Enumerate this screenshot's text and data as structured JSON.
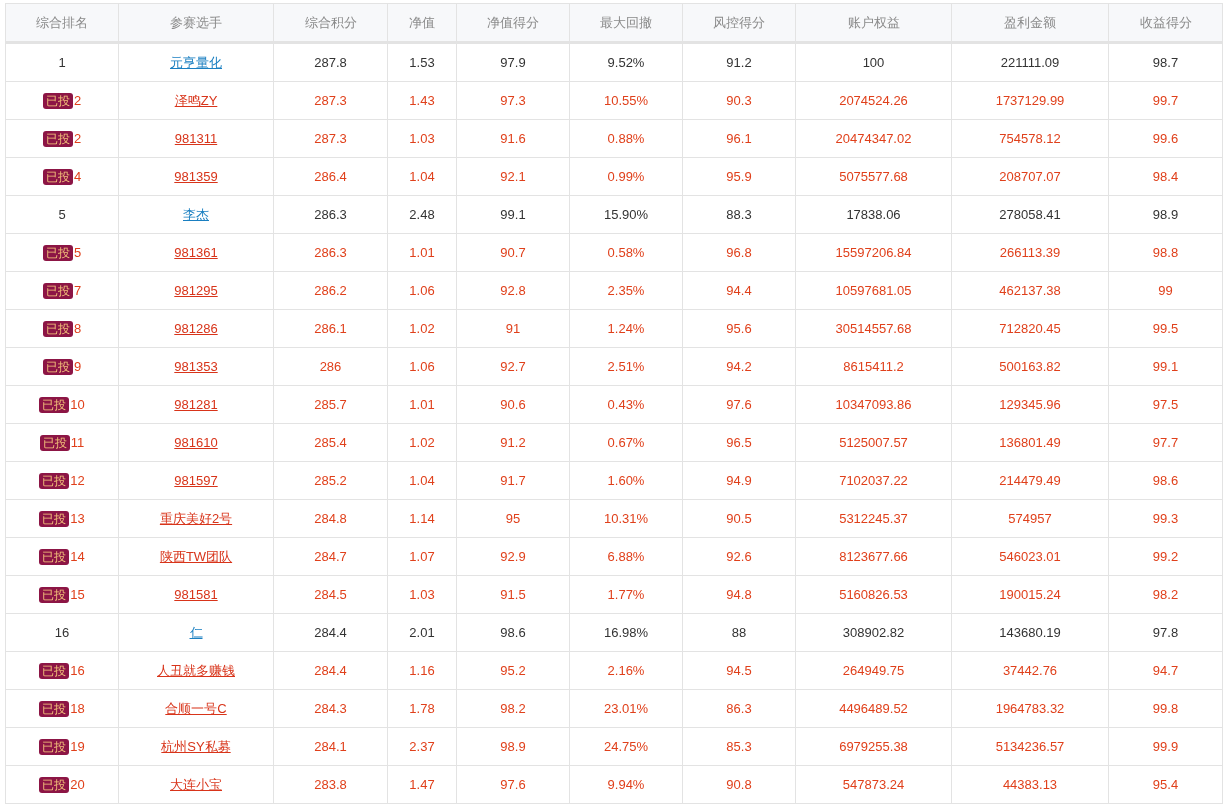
{
  "table": {
    "columns": [
      "综合排名",
      "参赛选手",
      "综合积分",
      "净值",
      "净值得分",
      "最大回撤",
      "风控得分",
      "账户权益",
      "盈利金额",
      "收益得分"
    ],
    "rows": [
      {
        "invested": false,
        "rank": "1",
        "player": "元亨量化",
        "values": [
          "287.8",
          "1.53",
          "97.9",
          "9.52%",
          "91.2",
          "100",
          "221111.09",
          "98.7"
        ]
      },
      {
        "invested": true,
        "badge": "已投",
        "rank": "2",
        "player": "泽鸣ZY",
        "values": [
          "287.3",
          "1.43",
          "97.3",
          "10.55%",
          "90.3",
          "2074524.26",
          "1737129.99",
          "99.7"
        ]
      },
      {
        "invested": true,
        "badge": "已投",
        "rank": "2",
        "player": "981311",
        "values": [
          "287.3",
          "1.03",
          "91.6",
          "0.88%",
          "96.1",
          "20474347.02",
          "754578.12",
          "99.6"
        ]
      },
      {
        "invested": true,
        "badge": "已投",
        "rank": "4",
        "player": "981359",
        "values": [
          "286.4",
          "1.04",
          "92.1",
          "0.99%",
          "95.9",
          "5075577.68",
          "208707.07",
          "98.4"
        ]
      },
      {
        "invested": false,
        "rank": "5",
        "player": "李杰",
        "values": [
          "286.3",
          "2.48",
          "99.1",
          "15.90%",
          "88.3",
          "17838.06",
          "278058.41",
          "98.9"
        ]
      },
      {
        "invested": true,
        "badge": "已投",
        "rank": "5",
        "player": "981361",
        "values": [
          "286.3",
          "1.01",
          "90.7",
          "0.58%",
          "96.8",
          "15597206.84",
          "266113.39",
          "98.8"
        ]
      },
      {
        "invested": true,
        "badge": "已投",
        "rank": "7",
        "player": "981295",
        "values": [
          "286.2",
          "1.06",
          "92.8",
          "2.35%",
          "94.4",
          "10597681.05",
          "462137.38",
          "99"
        ]
      },
      {
        "invested": true,
        "badge": "已投",
        "rank": "8",
        "player": "981286",
        "values": [
          "286.1",
          "1.02",
          "91",
          "1.24%",
          "95.6",
          "30514557.68",
          "712820.45",
          "99.5"
        ]
      },
      {
        "invested": true,
        "badge": "已投",
        "rank": "9",
        "player": "981353",
        "values": [
          "286",
          "1.06",
          "92.7",
          "2.51%",
          "94.2",
          "8615411.2",
          "500163.82",
          "99.1"
        ]
      },
      {
        "invested": true,
        "badge": "已投",
        "rank": "10",
        "player": "981281",
        "values": [
          "285.7",
          "1.01",
          "90.6",
          "0.43%",
          "97.6",
          "10347093.86",
          "129345.96",
          "97.5"
        ]
      },
      {
        "invested": true,
        "badge": "已投",
        "rank": "11",
        "player": "981610",
        "values": [
          "285.4",
          "1.02",
          "91.2",
          "0.67%",
          "96.5",
          "5125007.57",
          "136801.49",
          "97.7"
        ]
      },
      {
        "invested": true,
        "badge": "已投",
        "rank": "12",
        "player": "981597",
        "values": [
          "285.2",
          "1.04",
          "91.7",
          "1.60%",
          "94.9",
          "7102037.22",
          "214479.49",
          "98.6"
        ]
      },
      {
        "invested": true,
        "badge": "已投",
        "rank": "13",
        "player": "重庆美好2号",
        "values": [
          "284.8",
          "1.14",
          "95",
          "10.31%",
          "90.5",
          "5312245.37",
          "574957",
          "99.3"
        ]
      },
      {
        "invested": true,
        "badge": "已投",
        "rank": "14",
        "player": "陕西TW团队",
        "values": [
          "284.7",
          "1.07",
          "92.9",
          "6.88%",
          "92.6",
          "8123677.66",
          "546023.01",
          "99.2"
        ]
      },
      {
        "invested": true,
        "badge": "已投",
        "rank": "15",
        "player": "981581",
        "values": [
          "284.5",
          "1.03",
          "91.5",
          "1.77%",
          "94.8",
          "5160826.53",
          "190015.24",
          "98.2"
        ]
      },
      {
        "invested": false,
        "rank": "16",
        "player": "仁",
        "values": [
          "284.4",
          "2.01",
          "98.6",
          "16.98%",
          "88",
          "308902.82",
          "143680.19",
          "97.8"
        ]
      },
      {
        "invested": true,
        "badge": "已投",
        "rank": "16",
        "player": "人丑就多赚钱",
        "values": [
          "284.4",
          "1.16",
          "95.2",
          "2.16%",
          "94.5",
          "264949.75",
          "37442.76",
          "94.7"
        ]
      },
      {
        "invested": true,
        "badge": "已投",
        "rank": "18",
        "player": "合顺一号C",
        "values": [
          "284.3",
          "1.78",
          "98.2",
          "23.01%",
          "86.3",
          "4496489.52",
          "1964783.32",
          "99.8"
        ]
      },
      {
        "invested": true,
        "badge": "已投",
        "rank": "19",
        "player": "杭州SY私募",
        "values": [
          "284.1",
          "2.37",
          "98.9",
          "24.75%",
          "85.3",
          "6979255.38",
          "5134236.57",
          "99.9"
        ]
      },
      {
        "invested": true,
        "badge": "已投",
        "rank": "20",
        "player": "大连小宝",
        "values": [
          "283.8",
          "1.47",
          "97.6",
          "9.94%",
          "90.8",
          "547873.24",
          "44383.13",
          "95.4"
        ]
      }
    ]
  }
}
